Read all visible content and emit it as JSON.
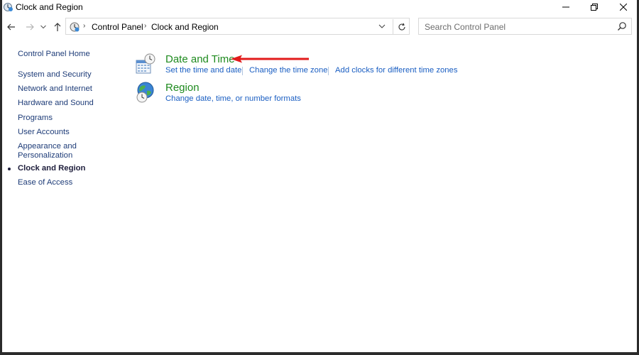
{
  "window": {
    "title": "Clock and Region"
  },
  "address_bar": {
    "breadcrumbs": [
      "Control Panel",
      "Clock and Region"
    ]
  },
  "search": {
    "placeholder": "Search Control Panel"
  },
  "sidebar": {
    "home": "Control Panel Home",
    "items": [
      {
        "label": "System and Security"
      },
      {
        "label": "Network and Internet"
      },
      {
        "label": "Hardware and Sound"
      },
      {
        "label": "Programs"
      },
      {
        "label": "User Accounts"
      },
      {
        "label": "Appearance and Personalization"
      },
      {
        "label": "Clock and Region",
        "active": true
      },
      {
        "label": "Ease of Access"
      }
    ]
  },
  "categories": [
    {
      "title": "Date and Time",
      "icon": "date-time-icon",
      "tasks": [
        "Set the time and date",
        "Change the time zone",
        "Add clocks for different time zones"
      ]
    },
    {
      "title": "Region",
      "icon": "globe-clock-icon",
      "tasks": [
        "Change date, time, or number formats"
      ]
    }
  ],
  "colors": {
    "link": "#1a5ec2",
    "category_title": "#1e8a1e",
    "annotation_arrow": "#e21b1b"
  }
}
